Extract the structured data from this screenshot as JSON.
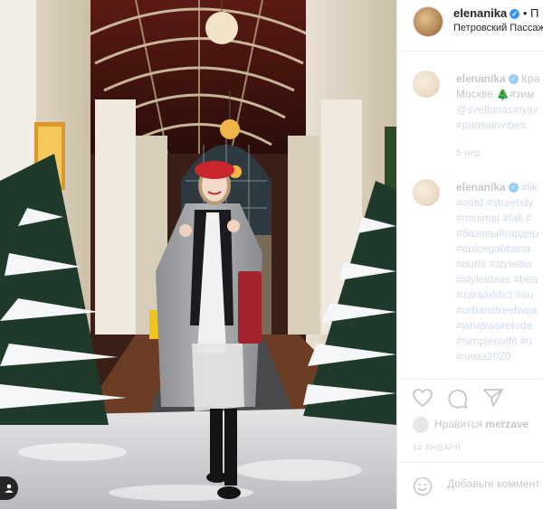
{
  "post": {
    "username": "elenanika",
    "location": "Петровский Пассаж",
    "header_separator": "• П"
  },
  "comments": [
    {
      "username": "elenanika",
      "lines": [
        "Кра",
        "Москве 🎄#зим",
        "@svetlanasinyav",
        "#parisianvibes"
      ],
      "time": "5 нед."
    },
    {
      "username": "elenanika",
      "lines": [
        "#lik",
        "#ootd #streetsty",
        "#minimal #fall #",
        "#базовыйгардер",
        "#dolcegabbana",
        "#outfit #styledia",
        "#styleideas #bea",
        "#zaraaddict #au",
        "#urbanstreetwea",
        "#whatiworetoda",
        "#simpleoutfit #u",
        "#зима2020"
      ]
    }
  ],
  "actions": {
    "like_icon": "heart-icon",
    "comment_icon": "comment-icon",
    "share_icon": "share-icon"
  },
  "likes": {
    "prefix": "Нравится",
    "username": "merzave"
  },
  "date": "14 ЯНВАРЯ",
  "add_comment": {
    "placeholder": "Добавьте коммент"
  },
  "colors": {
    "link": "#00376b",
    "verified": "#3897f0",
    "faded_text": "#c7c7c7"
  }
}
